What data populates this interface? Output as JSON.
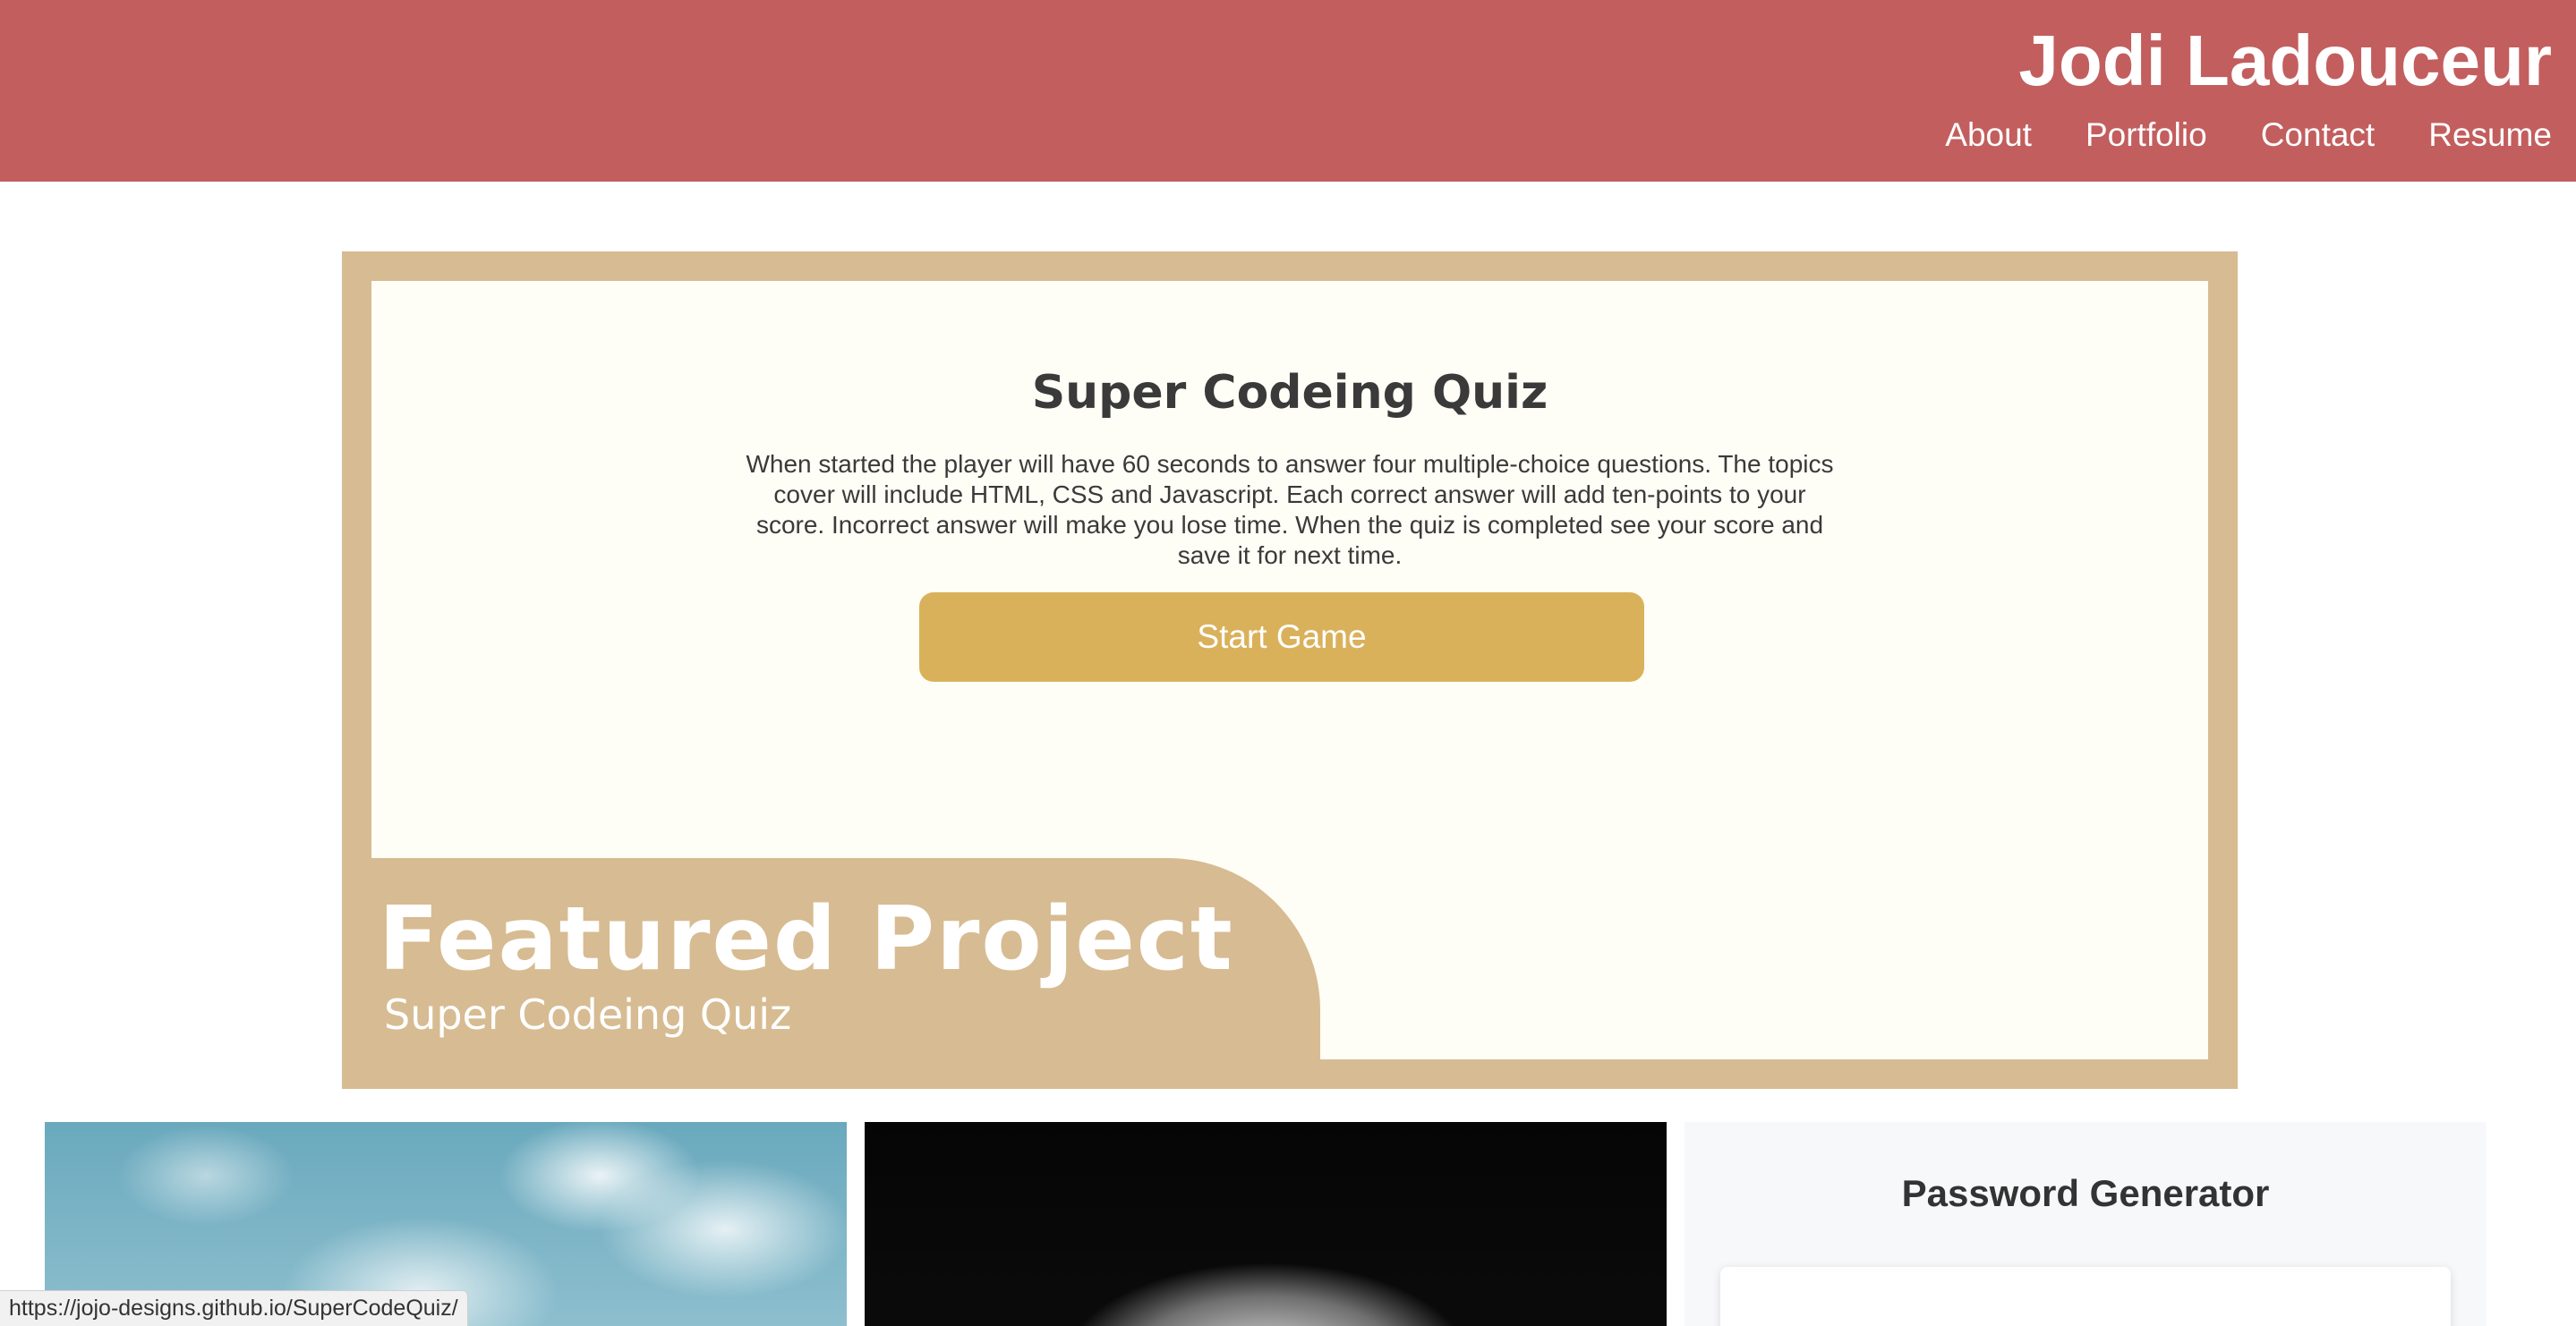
{
  "header": {
    "site_title": "Jodi Ladouceur",
    "nav": [
      "About",
      "Portfolio",
      "Contact",
      "Resume"
    ]
  },
  "featured": {
    "quiz_title": "Super Codeing Quiz",
    "quiz_description": "When started the player will have 60 seconds to answer four multiple-choice questions. The topics cover will include HTML, CSS and Javascript. Each correct answer will add ten-points to your score. Incorrect answer will make you lose time. When the quiz is completed see your score and save it for next time.",
    "start_button": "Start Game",
    "heading": "Featured Project",
    "subheading": "Super Codeing Quiz"
  },
  "cards": {
    "password_generator_title": "Password Generator"
  },
  "status_bar": {
    "url": "https://jojo-designs.github.io/SuperCodeQuiz/"
  },
  "colors": {
    "header_bg": "#c35e5e",
    "frame": "#d7bb92",
    "panel": "#fefdf6",
    "button": "#dab15b"
  }
}
